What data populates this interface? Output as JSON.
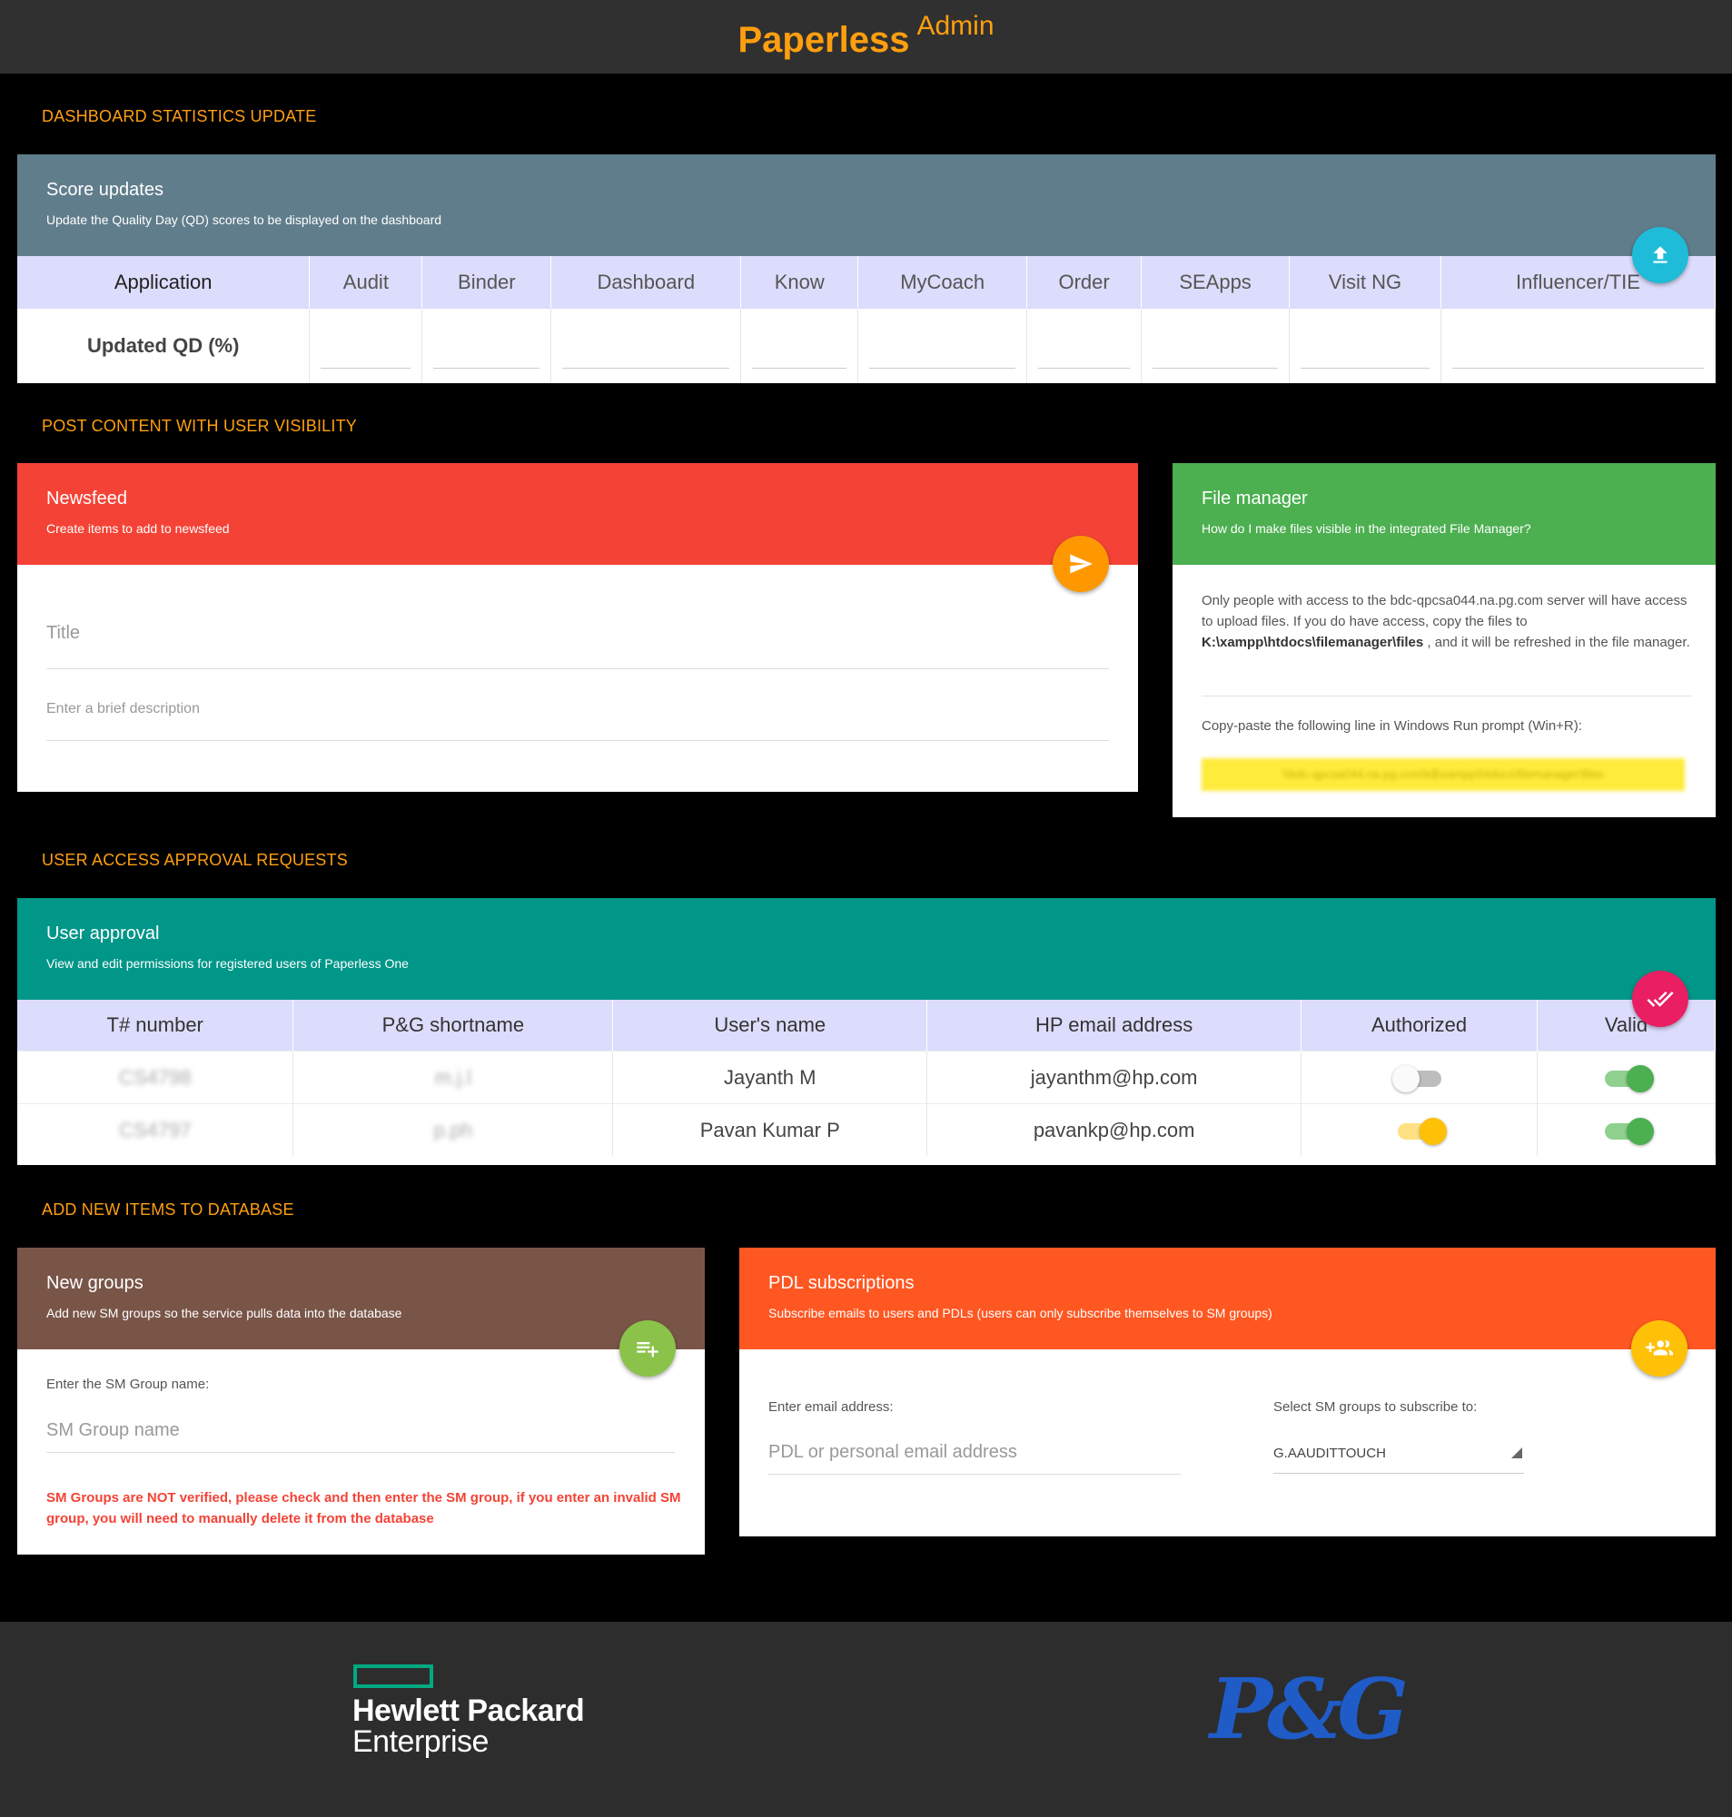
{
  "app": {
    "brand": "Paperless",
    "brand_suffix": "Admin"
  },
  "sections": {
    "dashboard": "DASHBOARD STATISTICS UPDATE",
    "post": "POST CONTENT WITH USER VISIBILITY",
    "approval": "USER ACCESS APPROVAL REQUESTS",
    "add_items": "ADD NEW ITEMS TO DATABASE"
  },
  "score_card": {
    "title": "Score updates",
    "subtitle": "Update the Quality Day (QD) scores to be displayed on the dashboard",
    "fab_icon": "upload-icon",
    "row_label": "Updated QD (%)",
    "columns": [
      "Application",
      "Audit",
      "Binder",
      "Dashboard",
      "Know",
      "MyCoach",
      "Order",
      "SEApps",
      "Visit NG",
      "Influencer/TIE"
    ]
  },
  "newsfeed": {
    "title": "Newsfeed",
    "subtitle": "Create items to add to newsfeed",
    "fab_icon": "send-icon",
    "title_placeholder": "Title",
    "desc_placeholder": "Enter a brief description"
  },
  "file_manager": {
    "title": "File manager",
    "subtitle": "How do I make files visible in the integrated File Manager?",
    "body_pre": "Only people with access to the bdc-qpcsa044.na.pg.com server will have access to upload files. If you do have access, copy the files to",
    "body_path": "K:\\xampp\\htdocs\\filemanager\\files",
    "body_post": ", and it will be refreshed in the file manager.",
    "copy_label": "Copy-paste the following line in Windows Run prompt (Win+R):",
    "highlight": "\\\\bdc-qpcsa044.na.pg.com\\k$\\xampp\\htdocs\\filemanager\\files"
  },
  "user_approval": {
    "title": "User approval",
    "subtitle": "View and edit permissions for registered users of Paperless One",
    "fab_icon": "double-check-icon",
    "columns": [
      "T# number",
      "P&G shortname",
      "User's name",
      "HP email address",
      "Authorized",
      "Valid"
    ],
    "rows": [
      {
        "tnumber": "CS4798",
        "shortname": "m.j.l",
        "name": "Jayanth M",
        "email": "jayanthm@hp.com",
        "authorized": false,
        "valid": true
      },
      {
        "tnumber": "CS4797",
        "shortname": "p.ph",
        "name": "Pavan Kumar P",
        "email": "pavankp@hp.com",
        "authorized": true,
        "valid": true
      }
    ]
  },
  "new_groups": {
    "title": "New groups",
    "subtitle": "Add new SM groups so the service pulls data into the database",
    "fab_icon": "playlist-add-icon",
    "label": "Enter the SM Group name:",
    "placeholder": "SM Group name",
    "warning": "SM Groups are NOT verified, please check and then enter the SM group, if you enter an invalid SM group, you will need to manually delete it from the database"
  },
  "pdl": {
    "title": "PDL subscriptions",
    "subtitle": "Subscribe emails to users and PDLs (users can only subscribe themselves to SM groups)",
    "fab_icon": "group-add-icon",
    "email_label": "Enter email address:",
    "email_placeholder": "PDL or personal email address",
    "select_label": "Select SM groups to subscribe to:",
    "select_value": "G.AAUDITTOUCH"
  },
  "footer": {
    "hpe_line1": "Hewlett Packard",
    "hpe_line2": "Enterprise",
    "pg_logo": "P&G"
  },
  "colors": {
    "accent": "#ff9f0f",
    "score_head": "#607d8b",
    "newsfeed_head": "#f44336",
    "file_head": "#4caf50",
    "approval_head": "#009688",
    "groups_head": "#795548",
    "pdl_head": "#ff5722"
  }
}
